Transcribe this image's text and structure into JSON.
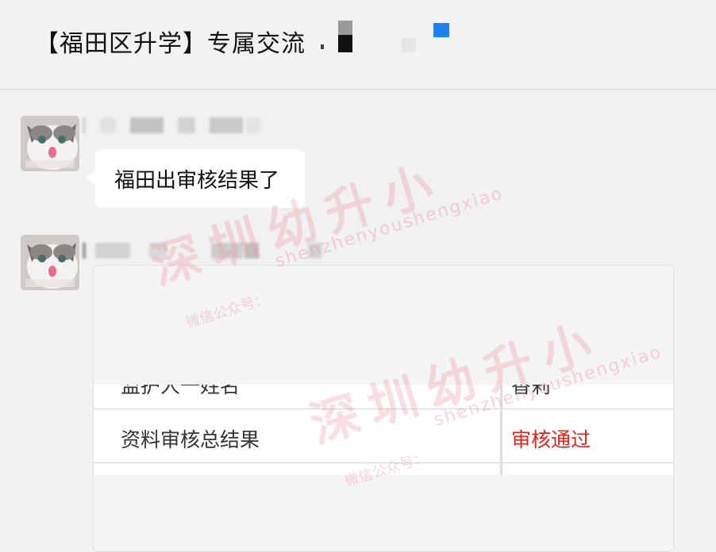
{
  "header": {
    "title": "【福田区升学】专属交流"
  },
  "messages": [
    {
      "text": "福田出审核结果了"
    }
  ],
  "card": {
    "partial_row": {
      "label": "监护人一姓名",
      "value": "香莉"
    },
    "rows": [
      {
        "label": "资料审核总结果",
        "value": "审核通过"
      }
    ]
  },
  "watermark": {
    "brand": "深圳幼升小",
    "pinyin": "shenzhenyoushengxiao",
    "account_label": "微信公众号："
  },
  "colors": {
    "accent_blue": "#1b82f0",
    "result_red": "#e2231a",
    "background": "#f1f1f1"
  }
}
